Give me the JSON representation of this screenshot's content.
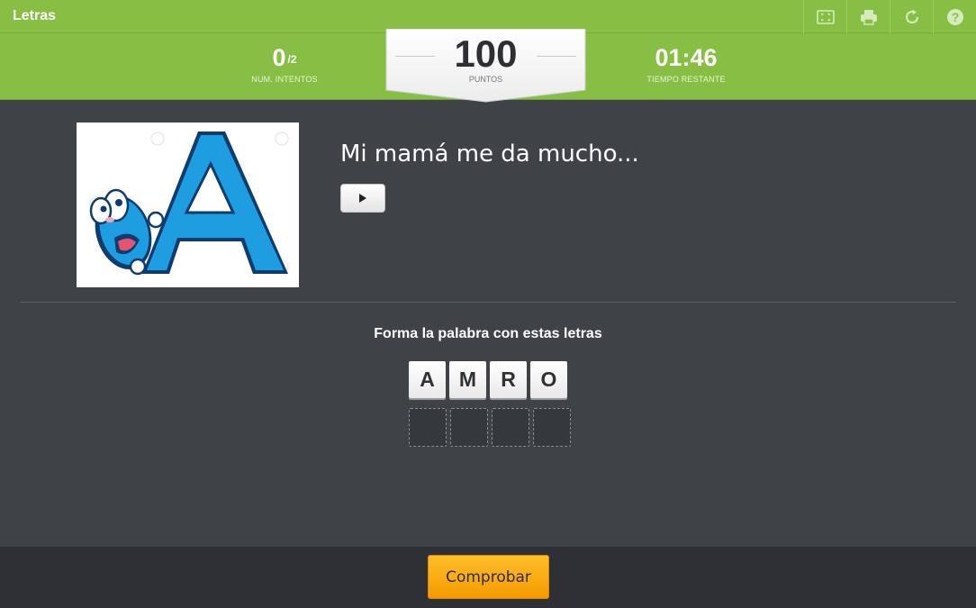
{
  "app": {
    "title": "Letras"
  },
  "toolbar": {
    "buttons": [
      "fullscreen-icon",
      "print-icon",
      "reload-icon",
      "help-icon"
    ]
  },
  "stats": {
    "attempts_value": "0",
    "attempts_total": "/2",
    "attempts_label": "NUM. INTENTOS",
    "score_value": "100",
    "score_label": "PUNTOS",
    "time_value": "01:46",
    "time_label": "TIEMPO RESTANTE"
  },
  "question": {
    "text": "Mi mamá me da mucho...",
    "audio_icon": "play-icon"
  },
  "puzzle": {
    "instructions": "Forma la palabra con estas letras",
    "letters": [
      "A",
      "M",
      "R",
      "O"
    ],
    "slot_count": 4
  },
  "footer": {
    "check_label": "Comprobar"
  },
  "colors": {
    "header_green": "#86bf43",
    "background": "#3f4247",
    "button_orange": "#f5a800",
    "letter_blue": "#1e9ee0"
  }
}
